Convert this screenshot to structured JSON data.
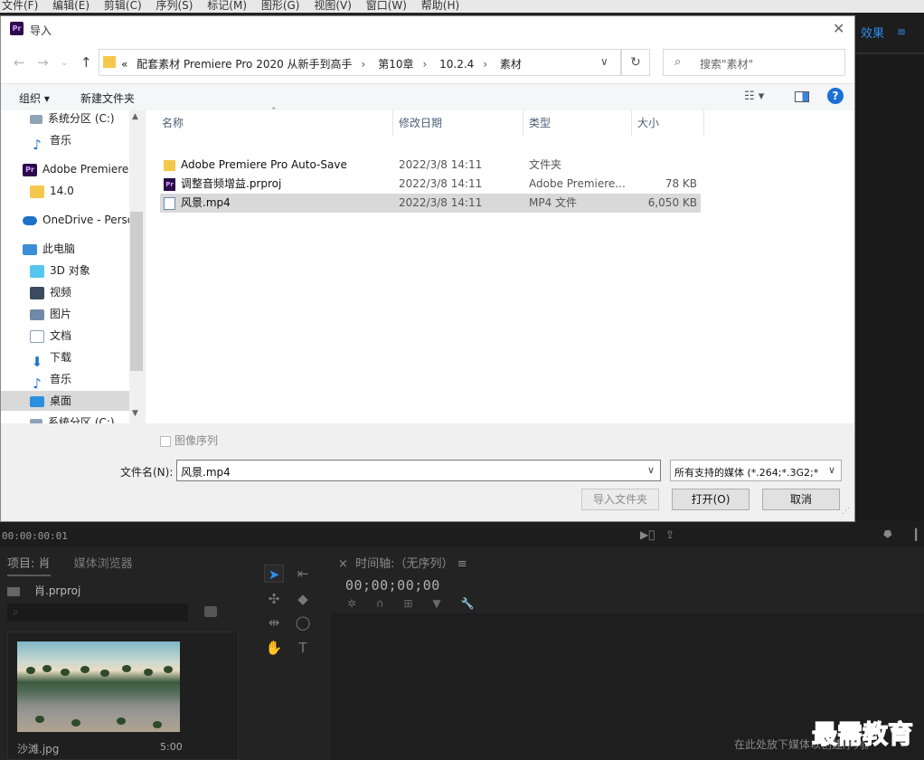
{
  "menubar": {
    "items": [
      "文件(F)",
      "编辑(E)",
      "剪辑(C)",
      "序列(S)",
      "标记(M)",
      "图形(G)",
      "视图(V)",
      "窗口(W)",
      "帮助(H)"
    ]
  },
  "premiere": {
    "effects_tab": "效果",
    "timecode_left": "00:00:00:01",
    "project_tab": "项目: 肖",
    "media_browser_tab": "媒体浏览器",
    "project_file": "肖.prproj",
    "clip_name": "沙滩.jpg",
    "clip_duration": "5:00",
    "timeline_title": "时间轴:（无序列）",
    "timeline_timecode": "00;00;00;00",
    "drop_hint": "在此处放下媒体以创建序列。"
  },
  "watermark": "最需教育",
  "dialog": {
    "title": "导入",
    "close_icon": "✕",
    "address": {
      "prefix": "«",
      "crumbs": [
        "配套素材 Premiere Pro 2020 从新手到高手",
        "第10章",
        "10.2.4",
        "素材"
      ]
    },
    "search_placeholder": "搜索\"素材\"",
    "toolbar": {
      "organize": "组织 ▾",
      "new_folder": "新建文件夹"
    },
    "tree": [
      {
        "label": "系统分区 (C:)",
        "icon": "drive-icon"
      },
      {
        "label": "音乐",
        "icon": "music-icon"
      },
      {
        "label": "Adobe Premiere",
        "icon": "premiere-icon"
      },
      {
        "label": "14.0",
        "icon": "folder-icon"
      },
      {
        "label": "OneDrive - Perso",
        "icon": "onedrive-icon"
      },
      {
        "label": "此电脑",
        "icon": "computer-icon"
      },
      {
        "label": "3D 对象",
        "icon": "3d-objects-icon"
      },
      {
        "label": "视频",
        "icon": "video-icon"
      },
      {
        "label": "图片",
        "icon": "pictures-icon"
      },
      {
        "label": "文档",
        "icon": "documents-icon"
      },
      {
        "label": "下载",
        "icon": "download-icon"
      },
      {
        "label": "音乐",
        "icon": "music-icon"
      },
      {
        "label": "桌面",
        "icon": "desktop-icon"
      },
      {
        "label": "系统分区 (C:)",
        "icon": "drive-icon"
      }
    ],
    "columns": {
      "name": "名称",
      "date": "修改日期",
      "type": "类型",
      "size": "大小"
    },
    "files": [
      {
        "name": "Adobe Premiere Pro Auto-Save",
        "date": "2022/3/8 14:11",
        "type": "文件夹",
        "size": "",
        "icon": "folder"
      },
      {
        "name": "调整音频增益.prproj",
        "date": "2022/3/8 14:11",
        "type": "Adobe Premiere...",
        "size": "78 KB",
        "icon": "pr"
      },
      {
        "name": "风景.mp4",
        "date": "2022/3/8 14:11",
        "type": "MP4 文件",
        "size": "6,050 KB",
        "icon": "mp4"
      }
    ],
    "image_sequence_label": "图像序列",
    "filename_label": "文件名(N):",
    "filename_value": "风景.mp4",
    "filter_value": "所有支持的媒体 (*.264;*.3G2;*",
    "buttons": {
      "import_folder": "导入文件夹",
      "open": "打开(O)",
      "cancel": "取消"
    }
  }
}
